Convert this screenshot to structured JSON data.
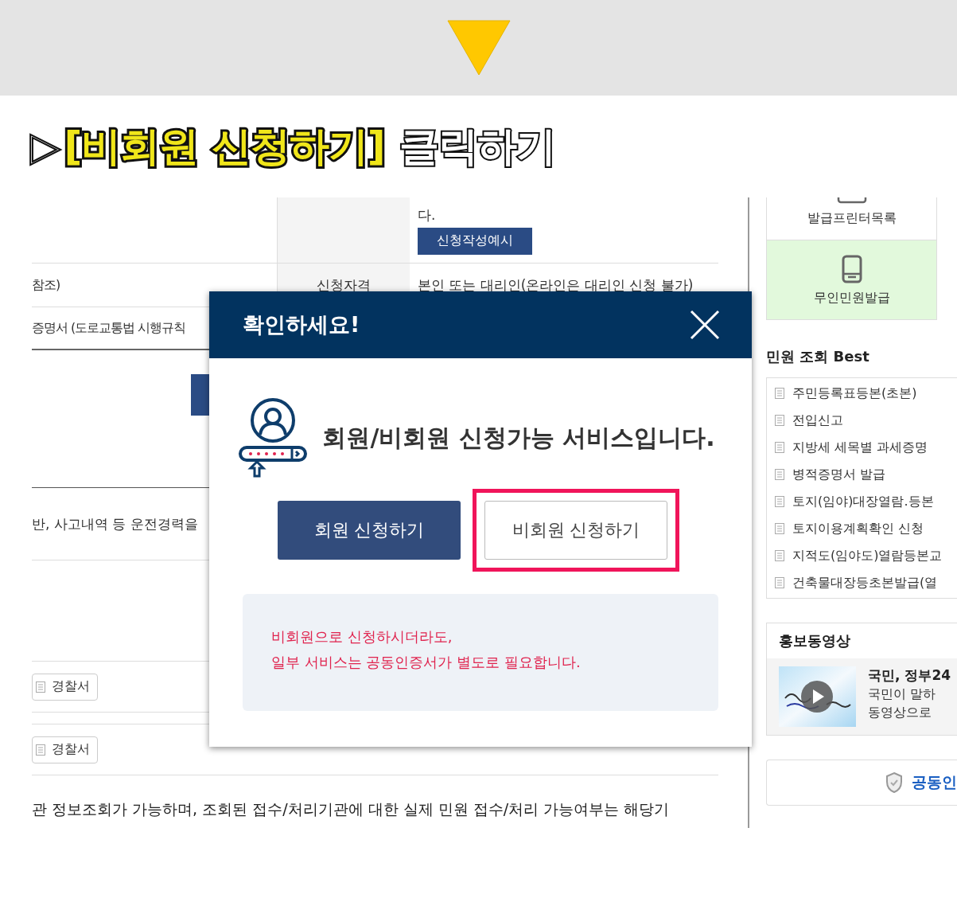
{
  "headline": {
    "marker": "▷",
    "highlight": "[비회원 신청하기]",
    "rest": "클릭하기"
  },
  "table": {
    "rows": [
      {
        "kind": "detail",
        "cells": [
          "",
          "",
          ""
        ],
        "tail": "다.",
        "button": "신청작성예시"
      },
      {
        "kind": "plain",
        "cells": [
          "참조)",
          "신청자격",
          "본인 또는 대리인(온라인은 대리인 신청 불가)"
        ]
      },
      {
        "kind": "plain",
        "cells": [
          "증명서 (도로교통법 시행규칙",
          "",
          ""
        ]
      }
    ]
  },
  "career_text": "반, 사고내역 등 운전경력을 ",
  "police_buttons": [
    "경찰서",
    "경찰서"
  ],
  "footer_text": "관 정보조회가 가능하며, 조회된 접수/처리기관에 대한 실제 민원 접수/처리 가능여부는 해당기",
  "sidebar": {
    "menu": [
      {
        "label": "발급프린터목록",
        "selected": false
      },
      {
        "label": "무인민원발급",
        "selected": true
      }
    ],
    "best_title": "민원 조회 Best",
    "best_items": [
      "주민등록표등본(초본)",
      "전입신고",
      "지방세 세목별 과세증명",
      "병적증명서 발급",
      "토지(임야)대장열람.등본",
      "토지이용계획확인 신청",
      "지적도(임야도)열람등본교",
      "건축물대장등초본발급(열"
    ],
    "video": {
      "title": "홍보동영상",
      "name": "국민, 정부24",
      "lines": [
        "국민이 말하",
        "동영상으로"
      ]
    },
    "cert": "공동인"
  },
  "modal": {
    "title": "확인하세요!",
    "message": "회원/비회원 신청가능 서비스입니다.",
    "buttons": [
      {
        "label": "회원 신청하기",
        "kind": "primary",
        "highlighted": false
      },
      {
        "label": "비회원 신청하기",
        "kind": "secondary",
        "highlighted": true
      }
    ],
    "notice": [
      "비회원으로 신청하시더라도,",
      "일부 서비스는 공동인증서가 별도로 필요합니다."
    ]
  }
}
